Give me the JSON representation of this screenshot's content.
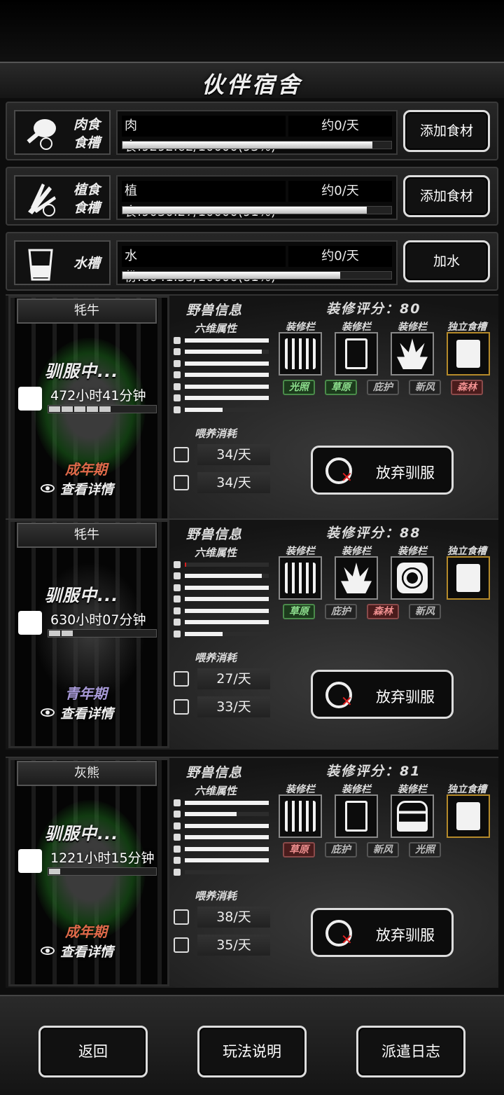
{
  "title": "伙伴宿舍",
  "troughs": [
    {
      "label_line1": "肉食",
      "label_line2": "食槽",
      "icon": "meat-drumstick-icon",
      "amount": "肉食:9292.62/10000(93%)",
      "rate": "约0/天",
      "fill": 0.93,
      "button": "添加食材"
    },
    {
      "label_line1": "植食",
      "label_line2": "食槽",
      "icon": "plant-bundle-icon",
      "amount": "植食:9030.27/10000(91%)",
      "rate": "约0/天",
      "fill": 0.91,
      "button": "添加食材"
    },
    {
      "label_line1": "水槽",
      "label_line2": "",
      "icon": "water-cup-icon",
      "amount": "水份:8041.53/10000(81%)",
      "rate": "约0/天",
      "fill": 0.81,
      "button": "加水"
    }
  ],
  "labels": {
    "beast_info": "野兽信息",
    "six_stats": "六维属性",
    "slot": "装修栏",
    "feeder": "独立食槽",
    "feeding": "喂养消耗",
    "taming": "驯服中...",
    "details": "查看详情",
    "abandon": "放弃驯服"
  },
  "beasts": [
    {
      "name": "牦牛",
      "timer": "472小时41分钟",
      "timer_segments": 5,
      "stage": "成年期",
      "stage_color": "#e06a4a",
      "score": "装修评分：80",
      "stats": [
        1.0,
        0.92,
        1.0,
        1.0,
        1.0,
        1.0,
        0.45
      ],
      "slots": [
        "gate-icon",
        "door-icon",
        "plant-icon"
      ],
      "tags": [
        {
          "text": "光照",
          "style": "green"
        },
        {
          "text": "草原",
          "style": "green"
        },
        {
          "text": "庇护",
          "style": "gray"
        },
        {
          "text": "新风",
          "style": "gray"
        },
        {
          "text": "森林",
          "style": "red"
        }
      ],
      "feed_plant": "34/天",
      "feed_water": "34/天"
    },
    {
      "name": "牦牛",
      "timer": "630小时07分钟",
      "timer_segments": 2,
      "stage": "青年期",
      "stage_color": "#a89ad8",
      "score": "装修评分：88",
      "stats": [
        0.02,
        0.92,
        1.0,
        1.0,
        1.0,
        1.0,
        0.45
      ],
      "slots": [
        "gate-icon",
        "plant-icon",
        "fan-icon"
      ],
      "tags": [
        {
          "text": "草原",
          "style": "green"
        },
        {
          "text": "庇护",
          "style": "gray"
        },
        {
          "text": "森林",
          "style": "red"
        },
        {
          "text": "新风",
          "style": "gray"
        }
      ],
      "feed_plant": "27/天",
      "feed_water": "33/天"
    },
    {
      "name": "灰熊",
      "timer": "1221小时15分钟",
      "timer_segments": 1,
      "stage": "成年期",
      "stage_color": "#e06a4a",
      "score": "装修评分：81",
      "stats": [
        1.0,
        0.62,
        1.0,
        1.0,
        1.0,
        1.0,
        0.0
      ],
      "slots": [
        "gate-icon",
        "door-icon",
        "vent-icon"
      ],
      "tags": [
        {
          "text": "草原",
          "style": "red"
        },
        {
          "text": "庇护",
          "style": "gray"
        },
        {
          "text": "新风",
          "style": "gray"
        },
        {
          "text": "光照",
          "style": "gray"
        }
      ],
      "feed_plant": "38/天",
      "feed_water": "35/天"
    }
  ],
  "footer": {
    "back": "返回",
    "help": "玩法说明",
    "log": "派遣日志"
  }
}
